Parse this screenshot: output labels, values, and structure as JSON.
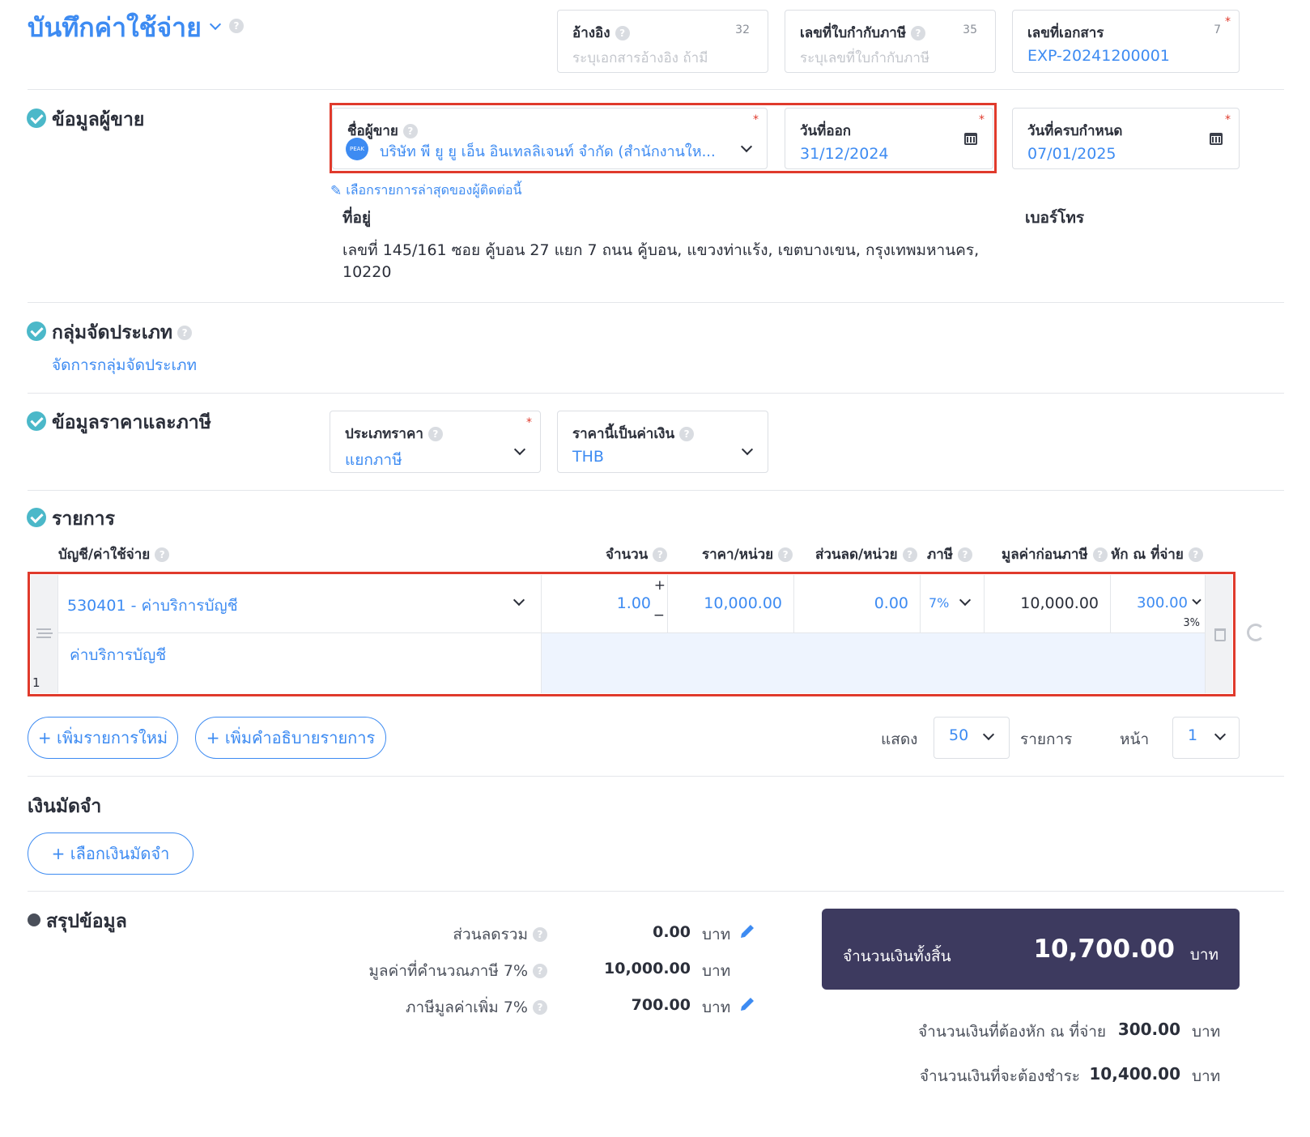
{
  "header": {
    "title": "บันทึกค่าใช้จ่าย",
    "reference": {
      "label": "อ้างอิง",
      "placeholder": "ระบุเอกสารอ้างอิง ถ้ามี",
      "counter": "32"
    },
    "tax_invoice": {
      "label": "เลขที่ใบกำกับภาษี",
      "placeholder": "ระบุเลขที่ใบกำกับภาษี",
      "counter": "35"
    },
    "document_no": {
      "label": "เลขที่เอกสาร",
      "value": "EXP-20241200001",
      "counter": "7"
    }
  },
  "vendor_section": {
    "title": "ข้อมูลผู้ขาย",
    "vendor_name": {
      "label": "ชื่อผู้ขาย",
      "value": "บริษัท พี ยู ยู เอ็น อินเทลลิเจนท์ จำกัด (สำนักงานให...",
      "avatar_text": "PEAK"
    },
    "issue_date": {
      "label": "วันที่ออก",
      "value": "31/12/2024"
    },
    "due_date": {
      "label": "วันที่ครบกำหนด",
      "value": "07/01/2025"
    },
    "recent_link": "เลือกรายการล่าสุดของผู้ติดต่อนี้",
    "address_label": "ที่อยู่",
    "address_line1": "เลขที่ 145/161 ซอย คู้บอน 27 แยก 7 ถนน คู้บอน, แขวงท่าแร้ง, เขตบางเขน, กรุงเทพมหานคร,",
    "address_line2": "10220",
    "phone_label": "เบอร์โทร"
  },
  "category_section": {
    "title": "กลุ่มจัดประเภท",
    "manage_link": "จัดการกลุ่มจัดประเภท"
  },
  "price_section": {
    "title": "ข้อมูลราคาและภาษี",
    "price_type": {
      "label": "ประเภทราคา",
      "value": "แยกภาษี"
    },
    "currency": {
      "label": "ราคานี้เป็นค่าเงิน",
      "value": "THB"
    }
  },
  "items_section": {
    "title": "รายการ",
    "columns": {
      "account": "บัญชี/ค่าใช้จ่าย",
      "qty": "จำนวน",
      "price": "ราคา/หน่วย",
      "discount": "ส่วนลด/หน่วย",
      "tax": "ภาษี",
      "pretax": "มูลค่าก่อนภาษี",
      "wht": "หัก ณ ที่จ่าย"
    },
    "rows": [
      {
        "index": "1",
        "account": "530401 - ค่าบริการบัญชี",
        "description": "ค่าบริการบัญชี",
        "qty": "1.00",
        "price": "10,000.00",
        "discount": "0.00",
        "tax": "7%",
        "pretax": "10,000.00",
        "wht": "300.00",
        "wht_rate": "3%"
      }
    ],
    "add_item": "+ เพิ่มรายการใหม่",
    "add_desc": "+ เพิ่มคำอธิบายรายการ",
    "show_label": "แสดง",
    "page_size": "50",
    "items_label": "รายการ",
    "page_label": "หน้า",
    "page": "1"
  },
  "deposit_section": {
    "title": "เงินมัดจำ",
    "select_button": "+ เลือกเงินมัดจำ"
  },
  "summary": {
    "title": "สรุปข้อมูล",
    "discount_total_label": "ส่วนลดรวม",
    "discount_total": "0.00",
    "taxable_label": "มูลค่าที่คำนวณภาษี 7%",
    "taxable": "10,000.00",
    "vat_label": "ภาษีมูลค่าเพิ่ม 7%",
    "vat": "700.00",
    "unit": "บาท",
    "grand_total_label": "จำนวนเงินทั้งสิ้น",
    "grand_total": "10,700.00",
    "wht_label": "จำนวนเงินที่ต้องหัก ณ ที่จ่าย",
    "wht": "300.00",
    "payable_label": "จำนวนเงินที่จะต้องชำระ",
    "payable": "10,400.00"
  },
  "colors": {
    "accent": "#3d8bf2",
    "highlight": "#e03a2c",
    "total_bg": "#3d3a5f",
    "check": "#4bb8c9"
  }
}
